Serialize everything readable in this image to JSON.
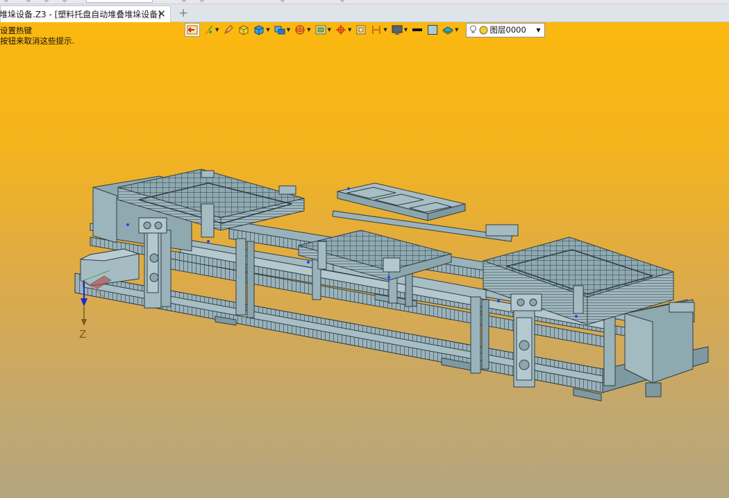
{
  "window": {
    "tab_title": "堆垛设备.Z3 - [塑料托盘自动堆叠堆垛设备]",
    "tab_close_glyph": "✕",
    "tab_add_glyph": "+"
  },
  "viewport": {
    "hint_line1": "设置热键",
    "hint_line2": "按钮来取消这些提示.",
    "background_top": "#fbb80f",
    "background_bottom": "#b3a580",
    "axis_label": "Z"
  },
  "toolbar": {
    "buttons": [
      {
        "icon": "return-icon",
        "has_dropdown": false
      },
      {
        "icon": "paint-brush-icon",
        "has_dropdown": true
      },
      {
        "icon": "pencil-icon",
        "has_dropdown": false
      },
      {
        "icon": "box-color-icon",
        "has_dropdown": false
      },
      {
        "icon": "cube-blue-icon",
        "has_dropdown": true
      },
      {
        "icon": "shaded-object-icon",
        "has_dropdown": true
      },
      {
        "icon": "wire-sphere-icon",
        "has_dropdown": true
      },
      {
        "icon": "frame-view-icon",
        "has_dropdown": true
      },
      {
        "icon": "snap-target-icon",
        "has_dropdown": true
      },
      {
        "icon": "square-select-icon",
        "has_dropdown": false
      },
      {
        "icon": "dimension-icon",
        "has_dropdown": true
      },
      {
        "icon": "monitor-icon",
        "has_dropdown": true
      },
      {
        "icon": "line-color-icon",
        "has_dropdown": false
      },
      {
        "icon": "fill-color-icon",
        "has_dropdown": false
      },
      {
        "icon": "layers-icon",
        "has_dropdown": true
      }
    ],
    "layer_select_value": "图层0000",
    "layer_caret": "▼"
  },
  "model": {
    "name": "塑料托盘自动堆叠堆垛设备",
    "part_color": "#9ab3bb",
    "edge_color": "#2f3d44"
  }
}
